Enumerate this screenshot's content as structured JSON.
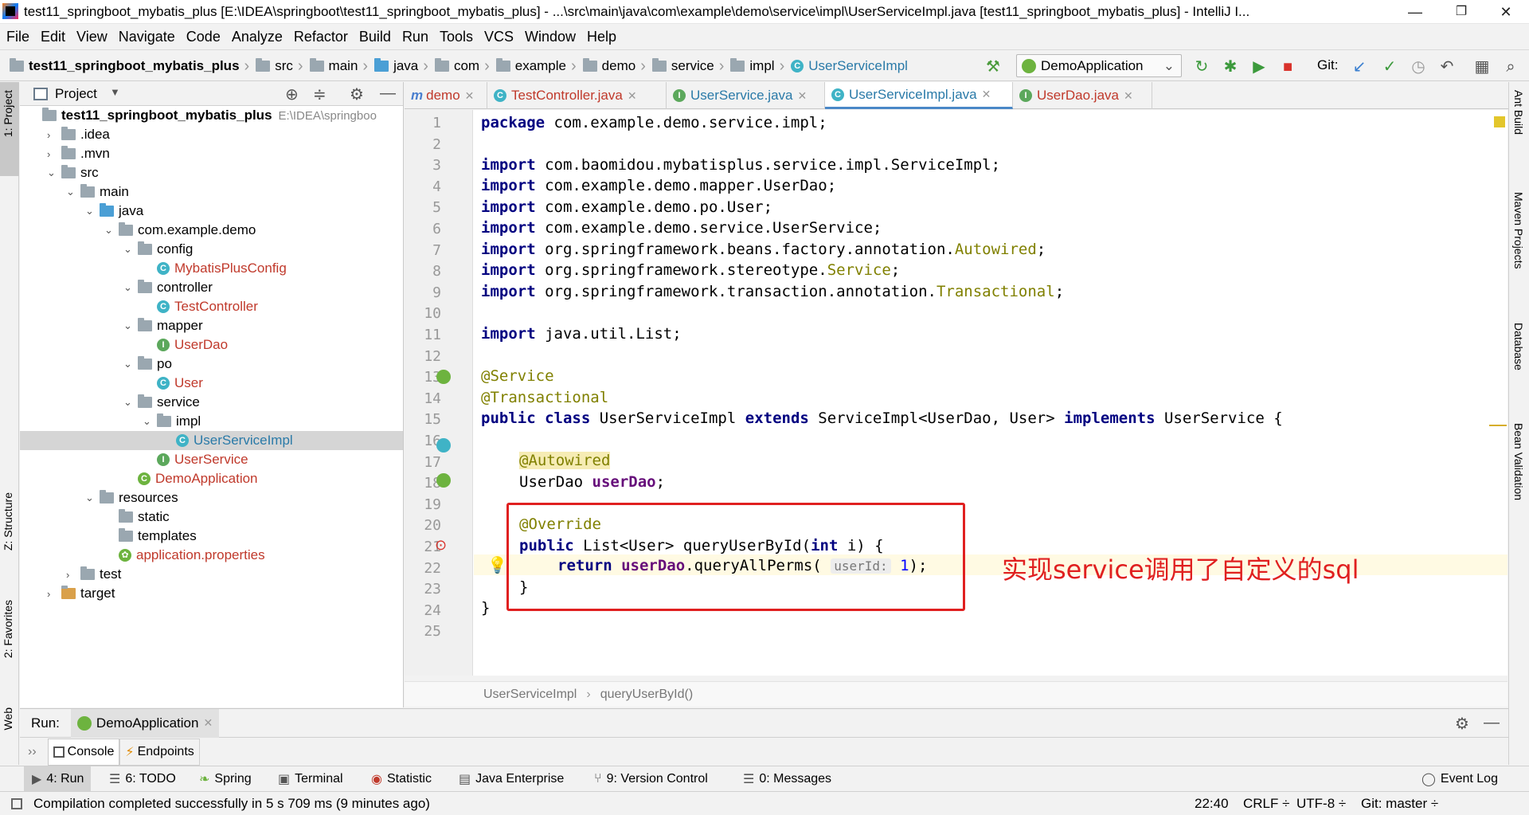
{
  "window": {
    "title": "test11_springboot_mybatis_plus [E:\\IDEA\\springboot\\test11_springboot_mybatis_plus] - ...\\src\\main\\java\\com\\example\\demo\\service\\impl\\UserServiceImpl.java [test11_springboot_mybatis_plus] - IntelliJ I...",
    "minimize": "—",
    "restore": "❐",
    "close": "✕"
  },
  "menu": [
    "File",
    "Edit",
    "View",
    "Navigate",
    "Code",
    "Analyze",
    "Refactor",
    "Build",
    "Run",
    "Tools",
    "VCS",
    "Window",
    "Help"
  ],
  "breadcrumbs": [
    "test11_springboot_mybatis_plus",
    "src",
    "main",
    "java",
    "com",
    "example",
    "demo",
    "service",
    "impl",
    "UserServiceImpl"
  ],
  "toolbar": {
    "run_config": "DemoApplication",
    "git_label": "Git:"
  },
  "project_panel": {
    "title": "Project",
    "root_name": "test11_springboot_mybatis_plus",
    "root_path": "E:\\IDEA\\springboo",
    "tree": [
      {
        "label": "test11_springboot_mybatis_plus",
        "depth": 0,
        "type": "root"
      },
      {
        "label": ".idea",
        "depth": 1,
        "type": "folder",
        "arrow": "›"
      },
      {
        "label": ".mvn",
        "depth": 1,
        "type": "folder",
        "arrow": "›"
      },
      {
        "label": "src",
        "depth": 1,
        "type": "folder",
        "arrow": "⌄"
      },
      {
        "label": "main",
        "depth": 2,
        "type": "folder",
        "arrow": "⌄"
      },
      {
        "label": "java",
        "depth": 3,
        "type": "folder-blue",
        "arrow": "⌄"
      },
      {
        "label": "com.example.demo",
        "depth": 4,
        "type": "package",
        "arrow": "⌄"
      },
      {
        "label": "config",
        "depth": 5,
        "type": "package",
        "arrow": "⌄"
      },
      {
        "label": "MybatisPlusConfig",
        "depth": 6,
        "type": "class"
      },
      {
        "label": "controller",
        "depth": 5,
        "type": "package",
        "arrow": "⌄"
      },
      {
        "label": "TestController",
        "depth": 6,
        "type": "class"
      },
      {
        "label": "mapper",
        "depth": 5,
        "type": "package",
        "arrow": "⌄"
      },
      {
        "label": "UserDao",
        "depth": 6,
        "type": "interface"
      },
      {
        "label": "po",
        "depth": 5,
        "type": "package",
        "arrow": "⌄"
      },
      {
        "label": "User",
        "depth": 6,
        "type": "class"
      },
      {
        "label": "service",
        "depth": 5,
        "type": "package",
        "arrow": "⌄"
      },
      {
        "label": "impl",
        "depth": 6,
        "type": "package",
        "arrow": "⌄"
      },
      {
        "label": "UserServiceImpl",
        "depth": 7,
        "type": "class",
        "selected": true
      },
      {
        "label": "UserService",
        "depth": 6,
        "type": "interface"
      },
      {
        "label": "DemoApplication",
        "depth": 5,
        "type": "spring-class"
      },
      {
        "label": "resources",
        "depth": 3,
        "type": "folder",
        "arrow": "⌄"
      },
      {
        "label": "static",
        "depth": 4,
        "type": "folder"
      },
      {
        "label": "templates",
        "depth": 4,
        "type": "folder"
      },
      {
        "label": "application.properties",
        "depth": 4,
        "type": "properties"
      },
      {
        "label": "test",
        "depth": 2,
        "type": "folder",
        "arrow": "›"
      },
      {
        "label": "target",
        "depth": 1,
        "type": "folder-orange",
        "arrow": "›"
      }
    ]
  },
  "tabs": [
    {
      "label": "demo",
      "icon": "m"
    },
    {
      "label": "TestController.java",
      "icon": "C"
    },
    {
      "label": "UserService.java",
      "icon": "I"
    },
    {
      "label": "UserServiceImpl.java",
      "icon": "C",
      "active": true
    },
    {
      "label": "UserDao.java",
      "icon": "I"
    }
  ],
  "editor": {
    "lines": [
      "1",
      "2",
      "3",
      "4",
      "5",
      "6",
      "7",
      "8",
      "9",
      "10",
      "11",
      "12",
      "13",
      "14",
      "15",
      "16",
      "17",
      "18",
      "19",
      "20",
      "21",
      "22",
      "23",
      "24",
      "25"
    ],
    "code": {
      "l1_kw": "package",
      "l1_rest": " com.example.demo.service.impl;",
      "l3_kw": "import",
      "l3_rest": " com.baomidou.mybatisplus.service.impl.ServiceImpl;",
      "l4_kw": "import",
      "l4_rest": " com.example.demo.mapper.UserDao;",
      "l5_kw": "import",
      "l5_rest": " com.example.demo.po.User;",
      "l6_kw": "import",
      "l6_rest": " com.example.demo.service.UserService;",
      "l7_kw": "import",
      "l7_rest": " org.springframework.beans.factory.annotation.",
      "l7_ann": "Autowired",
      "l8_kw": "import",
      "l8_rest": " org.springframework.stereotype.",
      "l8_ann": "Service",
      "l9_kw": "import",
      "l9_rest": " org.springframework.transaction.annotation.",
      "l9_ann": "Transactional",
      "l11_kw": "import",
      "l11_rest": " java.util.List;",
      "l13": "@Service",
      "l14": "@Transactional",
      "l15_kw1": "public class",
      "l15_a": " UserServiceImpl ",
      "l15_kw2": "extends",
      "l15_b": " ServiceImpl<UserDao, User> ",
      "l15_kw3": "implements",
      "l15_c": " UserService {",
      "l17": "@Autowired",
      "l18_a": "UserDao ",
      "l18_f": "userDao",
      "l18_b": ";",
      "l20": "@Override",
      "l21_kw": "public",
      "l21_a": " List<User> queryUserById(",
      "l21_kw2": "int",
      "l21_b": " i) {",
      "l22_kw": "return",
      "l22_f": " userDao",
      "l22_a": ".queryAllPerms(",
      "l22_hint": "userId:",
      "l22_num": "1",
      "l22_b": ");",
      "l23": "}",
      "l24": "}"
    },
    "annotation_note": "实现service调用了自定义的sql"
  },
  "editor_breadcrumb": [
    "UserServiceImpl",
    "queryUserById()"
  ],
  "right_tools": [
    "Ant Build",
    "Maven Projects",
    "Database",
    "Bean Validation"
  ],
  "left_tools": [
    "1: Project",
    "Z: Structure",
    "2: Favorites",
    "Web"
  ],
  "run_panel": {
    "label": "Run:",
    "config": "DemoApplication",
    "tabs": [
      "Console",
      "Endpoints"
    ]
  },
  "tool_tabs": [
    "4: Run",
    "6: TODO",
    "Spring",
    "Terminal",
    "Statistic",
    "Java Enterprise",
    "9: Version Control",
    "0: Messages",
    "Event Log"
  ],
  "status": {
    "message": "Compilation completed successfully in 5 s 709 ms (9 minutes ago)",
    "position": "22:40",
    "line_sep": "CRLF ÷",
    "encoding": "UTF-8 ÷",
    "git": "Git: master ÷"
  }
}
